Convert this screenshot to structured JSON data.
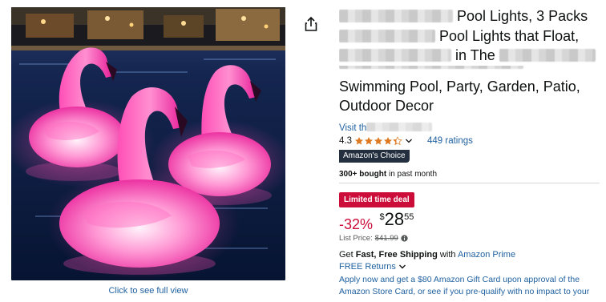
{
  "image": {
    "alt_icon": "inflatable-flamingo-pool-lights-photo",
    "see_full_view": "Click to see full view"
  },
  "share": {
    "icon": "share-icon"
  },
  "product": {
    "title_lines": [
      {
        "visible_text": "Pool Lights, 3 Packs"
      },
      {
        "visible_text": "Pool Lights that Float,"
      },
      {
        "visible_text": "in The"
      },
      {
        "visible_text": ""
      },
      {
        "visible_text": "Swimming Pool, Party, Garden, Patio,"
      },
      {
        "visible_text": "Outdoor Decor"
      }
    ],
    "store_link_prefix": "Visit th",
    "rating_value": "4.3",
    "stars_filled": 4.3,
    "ratings_count": "449 ratings",
    "choice_badge_prefix": "Amazon's",
    "choice_badge_suffix": "Choice",
    "bought_bold": "300+ bought",
    "bought_rest": " in past month",
    "deal_badge": "Limited time deal",
    "discount": "-32%",
    "price_symbol": "$",
    "price_whole": "28",
    "price_fraction": "55",
    "list_price_label": "List Price:",
    "list_price_value": "$41.99",
    "shipping_prefix": "Get ",
    "shipping_bold": "Fast, Free Shipping",
    "shipping_mid": " with ",
    "shipping_link": "Amazon Prime",
    "returns_label": "FREE Returns",
    "gift_offer": "Apply now and get a $80 Amazon Gift Card upon approval of the Amazon Store Card, or see if you pre-qualify with no impact to your"
  },
  "colors": {
    "link": "#2162a1",
    "deal_red": "#cc0c39",
    "star_orange": "#de7921",
    "choice_bg": "#232f3e",
    "flamingo_pink": "#ff3fae",
    "pool_water": "#0b1b3f"
  }
}
